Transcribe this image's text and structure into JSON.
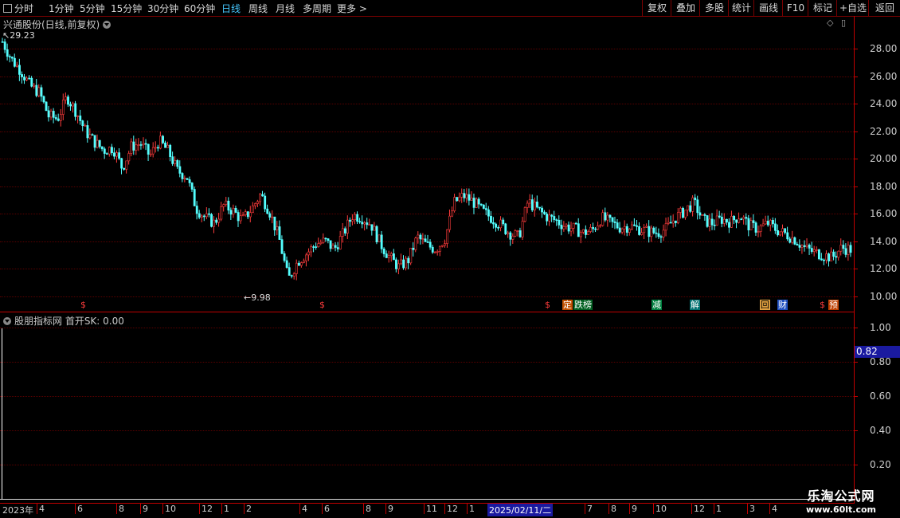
{
  "toolbar": {
    "timeframes": [
      "分时",
      "1分钟",
      "5分钟",
      "15分钟",
      "30分钟",
      "60分钟",
      "日线",
      "周线",
      "月线",
      "多周期",
      "更多 >"
    ],
    "active": "日线",
    "right_buttons": [
      "复权",
      "叠加",
      "多股",
      "统计",
      "画线",
      "F10",
      "标记",
      "+自选",
      "返回"
    ]
  },
  "main_pane": {
    "title": "兴通股份(日线,前复权)",
    "high_label": "29.23",
    "low_label": "9.98",
    "price_axis": [
      "28.00",
      "26.00",
      "24.00",
      "22.00",
      "20.00",
      "18.00",
      "16.00",
      "14.00",
      "12.00",
      "10.00"
    ]
  },
  "indicator_pane": {
    "title": "股朋指标网 首开SK: 0.00",
    "axis": [
      "1.00",
      "0.80",
      "0.60",
      "0.40",
      "0.20"
    ],
    "current_value": "0.82"
  },
  "event_tags": {
    "s_marker": "$",
    "ding": "定",
    "diebang": "跌榜",
    "jian": "减",
    "jie": "解",
    "hui": "回",
    "cai": "财",
    "yu": "预"
  },
  "date_axis": {
    "first": "2023年",
    "highlight": "2025/02/11/二",
    "ticks": [
      "4",
      "6",
      "8",
      "9",
      "10",
      "12",
      "1",
      "2",
      "4",
      "6",
      "8",
      "9",
      "11",
      "12",
      "1",
      "7",
      "8",
      "9",
      "10",
      "12",
      "1",
      "3",
      "4"
    ]
  },
  "watermark": {
    "name": "乐淘公式网",
    "url": "www.60lt.com"
  },
  "colors": {
    "up": "#ff3c3c",
    "down": "#54ffff",
    "grid": "#5a0000",
    "border": "#c00000",
    "highlight_bg": "#1a1aa0"
  },
  "chart_data": {
    "type": "candlestick",
    "y_range": [
      9.5,
      30
    ],
    "high": 29.23,
    "low": 9.98,
    "close_series": [
      28.5,
      27.2,
      26.4,
      25.3,
      24.8,
      23.1,
      22.9,
      24.5,
      23.4,
      22.0,
      21.2,
      20.6,
      20.8,
      19.3,
      20.9,
      21.1,
      20.2,
      21.3,
      20.5,
      19.1,
      18.7,
      16.4,
      15.7,
      15.3,
      16.6,
      16.2,
      15.5,
      16.3,
      17.4,
      16.1,
      14.2,
      11.2,
      12.5,
      13.1,
      13.8,
      14.0,
      13.4,
      14.6,
      15.9,
      15.7,
      15.2,
      13.8,
      12.8,
      12.1,
      12.6,
      14.3,
      13.7,
      13.4,
      14.2,
      16.8,
      17.3,
      16.9,
      16.2,
      15.7,
      15.2,
      14.6,
      14.3,
      16.9,
      16.3,
      15.8,
      15.5,
      15.1,
      14.9,
      14.6,
      14.8,
      15.7,
      15.3,
      15.0,
      15.1,
      14.9,
      14.7,
      14.6,
      14.9,
      15.7,
      16.2,
      16.8,
      15.5,
      15.3,
      15.6,
      15.4,
      15.9,
      15.1,
      14.9,
      15.3,
      14.8,
      14.5,
      14.1,
      13.5,
      13.2,
      13.0,
      12.8,
      13.5,
      13.4
    ]
  }
}
